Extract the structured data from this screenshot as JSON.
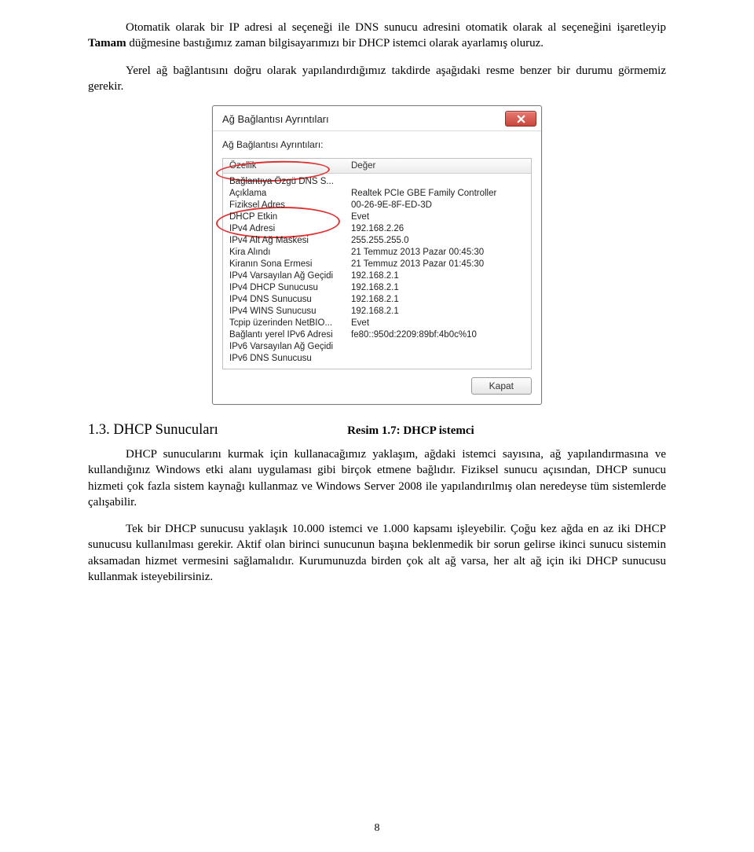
{
  "paragraphs": {
    "p1_a": "Otomatik olarak bir IP adresi al seçeneği ile DNS sunucu adresini otomatik olarak al seçeneğini işaretleyip ",
    "p1_b": "Tamam",
    "p1_c": " düğmesine bastığımız zaman bilgisayarımızı bir DHCP istemci olarak ayarlamış oluruz.",
    "p2": "Yerel ağ bağlantısını doğru olarak yapılandırdığımız takdirde aşağıdaki resme benzer bir durumu görmemiz gerekir.",
    "p3": "DHCP sunucularını kurmak için kullanacağımız yaklaşım, ağdaki istemci sayısına, ağ yapılandırmasına ve kullandığınız Windows etki alanı uygulaması gibi birçok etmene bağlıdır. Fiziksel sunucu açısından, DHCP sunucu hizmeti çok fazla sistem kaynağı kullanmaz ve Windows Server 2008 ile yapılandırılmış olan neredeyse tüm sistemlerde çalışabilir.",
    "p4": "Tek bir DHCP sunucusu yaklaşık 10.000 istemci ve 1.000 kapsamı işleyebilir. Çoğu kez ağda en az iki DHCP sunucusu kullanılması gerekir. Aktif olan birinci sunucunun başına beklenmedik bir sorun gelirse ikinci sunucu sistemin aksamadan hizmet vermesini sağlamalıdır. Kurumunuzda birden çok alt ağ varsa, her alt ağ için iki DHCP sunucusu kullanmak isteyebilirsiniz."
  },
  "caption": "Resim 1.7: DHCP istemci",
  "section": "1.3. DHCP Sunucuları",
  "pageNumber": "8",
  "dialog": {
    "title": "Ağ Bağlantısı Ayrıntıları",
    "subtitle": "Ağ Bağlantısı Ayrıntıları:",
    "head_l": "Özellik",
    "head_r": "Değer",
    "closeLabel": "Kapat",
    "rows": [
      {
        "l": "Bağlantıya Özgü DNS S...",
        "r": ""
      },
      {
        "l": "Açıklama",
        "r": "Realtek PCIe GBE Family Controller"
      },
      {
        "l": "Fiziksel Adres",
        "r": "00-26-9E-8F-ED-3D"
      },
      {
        "l": "DHCP Etkin",
        "r": "Evet"
      },
      {
        "l": "IPv4 Adresi",
        "r": "192.168.2.26"
      },
      {
        "l": "IPv4 Alt Ağ Maskesi",
        "r": "255.255.255.0"
      },
      {
        "l": "Kira Alındı",
        "r": "21 Temmuz 2013 Pazar 00:45:30"
      },
      {
        "l": "Kiranın Sona Ermesi",
        "r": "21 Temmuz 2013 Pazar 01:45:30"
      },
      {
        "l": "IPv4 Varsayılan Ağ Geçidi",
        "r": "192.168.2.1"
      },
      {
        "l": "IPv4 DHCP Sunucusu",
        "r": "192.168.2.1"
      },
      {
        "l": "IPv4 DNS Sunucusu",
        "r": "192.168.2.1"
      },
      {
        "l": "IPv4 WINS Sunucusu",
        "r": "192.168.2.1"
      },
      {
        "l": "Tcpip üzerinden NetBIO...",
        "r": "Evet"
      },
      {
        "l": "Bağlantı yerel IPv6 Adresi",
        "r": "fe80::950d:2209:89bf:4b0c%10"
      },
      {
        "l": "IPv6 Varsayılan Ağ Geçidi",
        "r": ""
      },
      {
        "l": "IPv6 DNS Sunucusu",
        "r": ""
      }
    ]
  }
}
